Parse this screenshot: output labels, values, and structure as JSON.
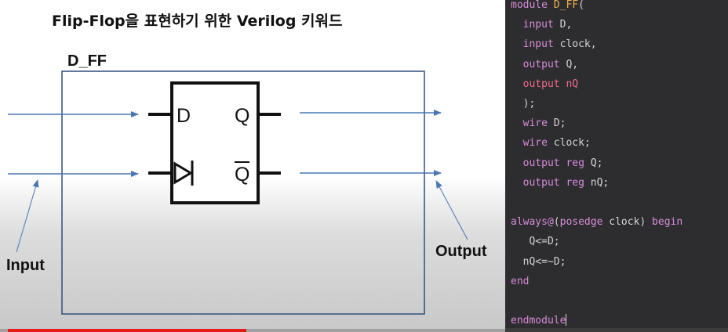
{
  "slide": {
    "title": "Flip-Flop을 표현하기 위한 Verilog 키워드",
    "module_label": "D_FF",
    "input_label": "Input",
    "output_label": "Output",
    "pin_d": "D",
    "pin_q": "Q",
    "pin_qbar": "Q"
  },
  "colors": {
    "signal_line": "#4a77b4",
    "box_border": "#2f4f7f",
    "progress": "#e61b1b",
    "editor_bg": "#2d2d30"
  },
  "video": {
    "progress_fraction": 0.48
  },
  "editor": {
    "lines": [
      {
        "segments": [
          {
            "t": "module ",
            "c": "kw-module"
          },
          {
            "t": "D_FF",
            "c": "kw-name"
          },
          {
            "t": "(",
            "c": "plain"
          }
        ]
      },
      {
        "segments": [
          {
            "t": "  ",
            "c": "plain"
          },
          {
            "t": "input",
            "c": "kw-io"
          },
          {
            "t": " D,",
            "c": "plain"
          }
        ]
      },
      {
        "segments": [
          {
            "t": "  ",
            "c": "plain"
          },
          {
            "t": "input",
            "c": "kw-io"
          },
          {
            "t": " clock,",
            "c": "plain"
          }
        ]
      },
      {
        "segments": [
          {
            "t": "  ",
            "c": "plain"
          },
          {
            "t": "output",
            "c": "kw-io"
          },
          {
            "t": " Q,",
            "c": "plain"
          }
        ]
      },
      {
        "segments": [
          {
            "t": "  ",
            "c": "plain"
          },
          {
            "t": "output nQ",
            "c": "kw-out"
          }
        ]
      },
      {
        "segments": [
          {
            "t": "  );",
            "c": "plain"
          }
        ]
      },
      {
        "segments": [
          {
            "t": "  ",
            "c": "plain"
          },
          {
            "t": "wire",
            "c": "kw-wire"
          },
          {
            "t": " D;",
            "c": "plain"
          }
        ]
      },
      {
        "segments": [
          {
            "t": "  ",
            "c": "plain"
          },
          {
            "t": "wire",
            "c": "kw-wire"
          },
          {
            "t": " clock;",
            "c": "plain"
          }
        ]
      },
      {
        "segments": [
          {
            "t": "  ",
            "c": "plain"
          },
          {
            "t": "output reg",
            "c": "kw-io"
          },
          {
            "t": " Q;",
            "c": "plain"
          }
        ]
      },
      {
        "segments": [
          {
            "t": "  ",
            "c": "plain"
          },
          {
            "t": "output reg",
            "c": "kw-io"
          },
          {
            "t": " nQ;",
            "c": "plain"
          }
        ]
      },
      {
        "segments": [
          {
            "t": "",
            "c": "plain"
          }
        ]
      },
      {
        "segments": [
          {
            "t": "always@",
            "c": "kw-always"
          },
          {
            "t": "(",
            "c": "plain"
          },
          {
            "t": "posedge",
            "c": "kw-always"
          },
          {
            "t": " clock) ",
            "c": "plain"
          },
          {
            "t": "begin",
            "c": "kw-always"
          }
        ]
      },
      {
        "segments": [
          {
            "t": "   Q<=D;",
            "c": "plain"
          }
        ]
      },
      {
        "segments": [
          {
            "t": "  nQ<=~D;",
            "c": "plain"
          }
        ]
      },
      {
        "segments": [
          {
            "t": "end",
            "c": "kw-always"
          }
        ]
      },
      {
        "segments": [
          {
            "t": "",
            "c": "plain"
          }
        ]
      },
      {
        "segments": [
          {
            "t": "endmodule",
            "c": "kw-module"
          }
        ]
      }
    ]
  }
}
